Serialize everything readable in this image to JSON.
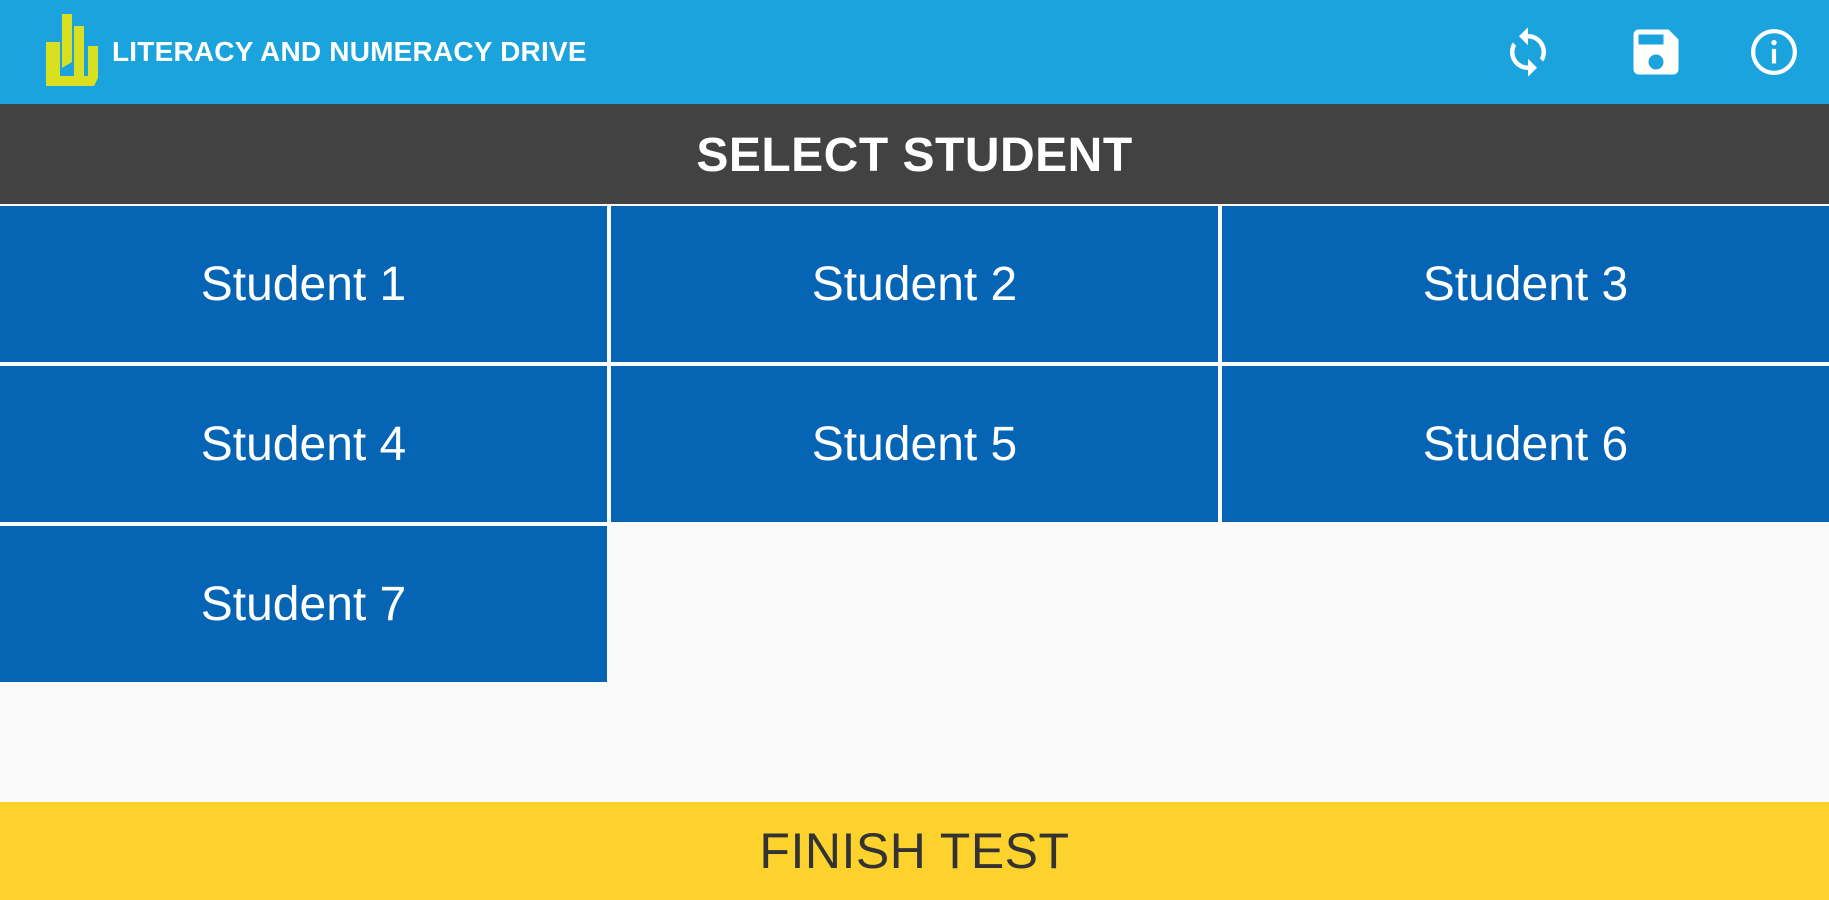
{
  "header": {
    "app_title": "LITERACY AND NUMERACY DRIVE",
    "logo_icon": "lnd-logo-icon",
    "actions": [
      {
        "icon": "sync-icon"
      },
      {
        "icon": "save-icon"
      },
      {
        "icon": "info-icon"
      }
    ],
    "background_color": "#1aa3dd",
    "logo_color": "#d8e021"
  },
  "section": {
    "title": "SELECT STUDENT",
    "background_color": "#424242"
  },
  "students": [
    {
      "label": "Student 1"
    },
    {
      "label": "Student 2"
    },
    {
      "label": "Student 3"
    },
    {
      "label": "Student 4"
    },
    {
      "label": "Student 5"
    },
    {
      "label": "Student 6"
    },
    {
      "label": "Student 7"
    }
  ],
  "tile_color": "#0565b4",
  "footer": {
    "finish_label": "FINISH TEST",
    "background_color": "#fdd22d"
  }
}
